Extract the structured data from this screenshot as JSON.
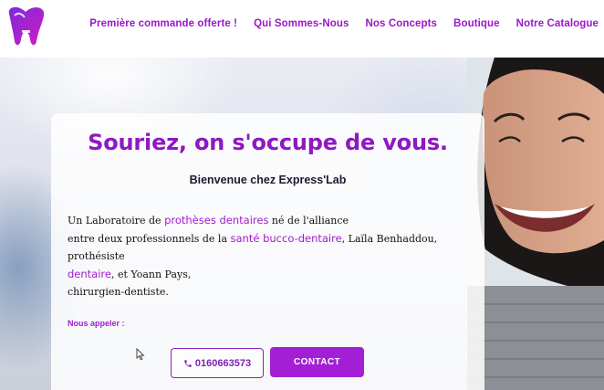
{
  "header": {
    "nav": [
      {
        "label": "Première commande offerte !"
      },
      {
        "label": "Qui Sommes-Nous"
      },
      {
        "label": "Nos Concepts"
      },
      {
        "label": "Boutique"
      },
      {
        "label": "Notre Catalogue"
      }
    ],
    "logo_icon": "tooth-logo-icon"
  },
  "hero": {
    "title": "Souriez, on s'occupe de vous.",
    "subtitle": "Bienvenue chez Express'Lab",
    "paragraph": {
      "t1": "Un Laboratoire de ",
      "h1": "prothèses dentaires",
      "t2": " né de l'alliance",
      "t3": "entre deux professionnels de la ",
      "h2": "santé bucco-dentaire",
      "t4": ", Laïla Benhaddou, prothésiste",
      "h3": "dentaire",
      "t5": ", et Yoann Pays,",
      "t6": "chirurgien-dentiste."
    },
    "call_label": "Nous appeler :",
    "phone_button": "0160663573",
    "phone_icon": "phone-icon",
    "contact_button": "CONTACT"
  },
  "colors": {
    "accent": "#a31fd6",
    "nav_text": "#9b17c9",
    "title": "#8e18c2"
  }
}
